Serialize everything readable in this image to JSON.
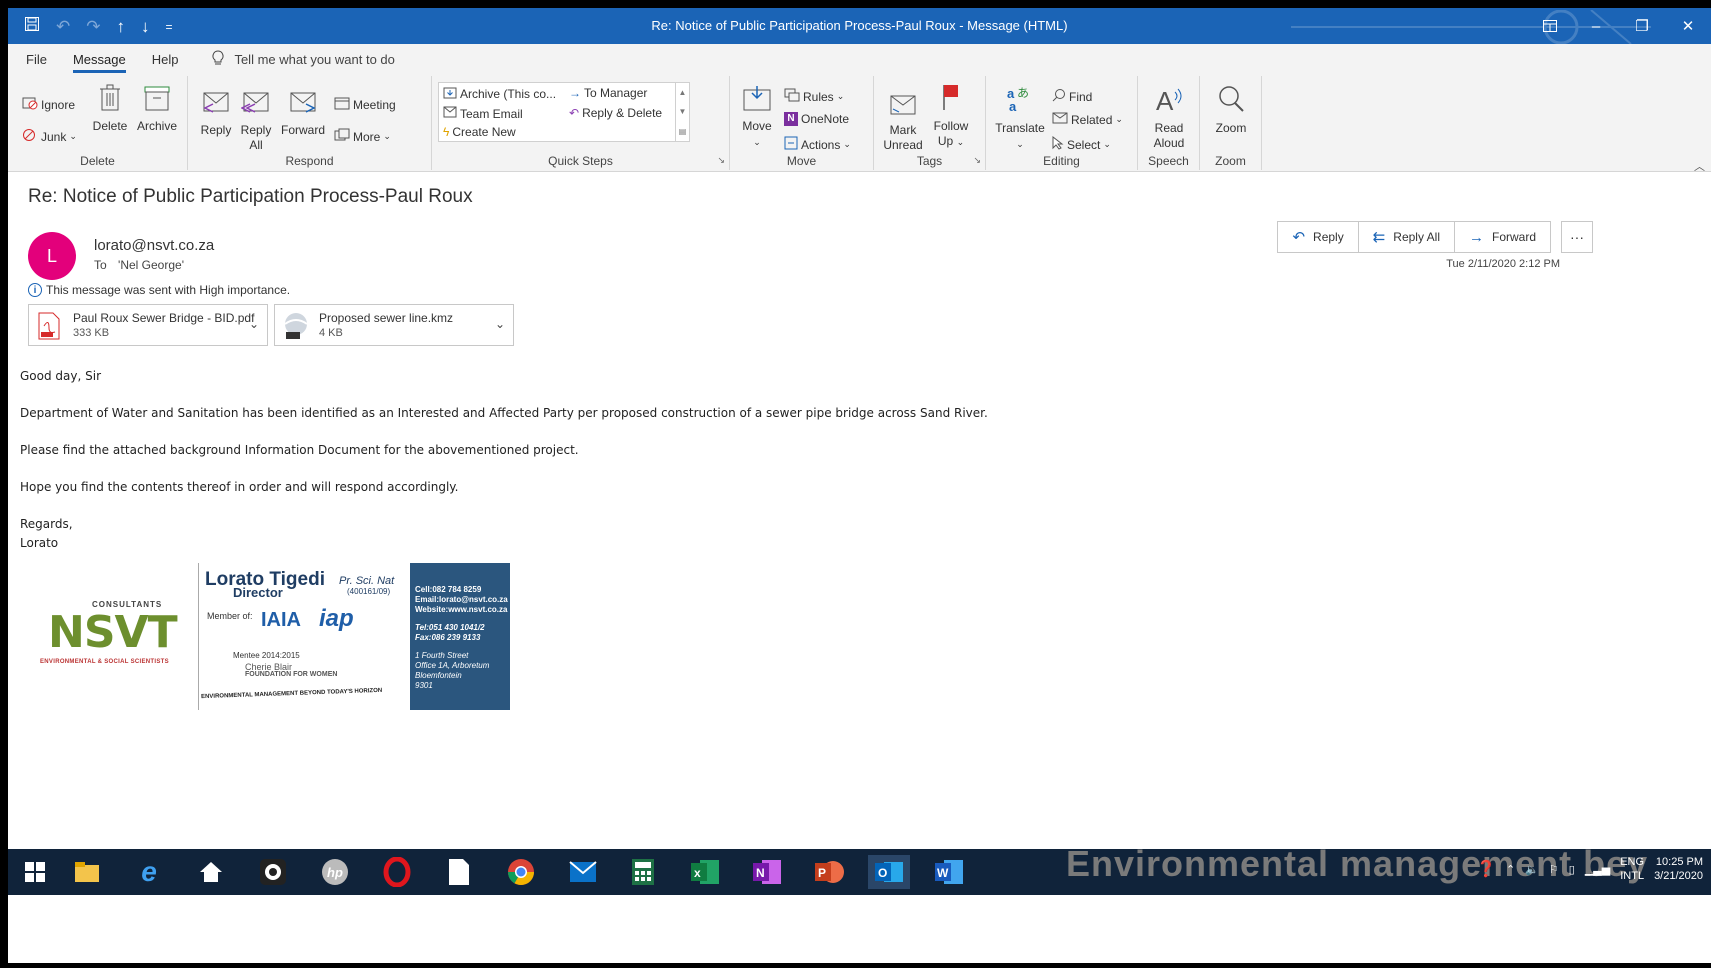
{
  "window": {
    "title": "Re: Notice of Public Participation Process-Paul Roux  -  Message (HTML)",
    "qat": [
      "save-icon",
      "undo-icon",
      "redo-icon",
      "up-arrow-icon",
      "down-arrow-icon",
      "customize-icon"
    ]
  },
  "tabs": {
    "file": "File",
    "message": "Message",
    "help": "Help",
    "tell_me": "Tell me what you want to do"
  },
  "ribbon": {
    "delete_group": {
      "label": "Delete",
      "ignore": "Ignore",
      "junk": "Junk",
      "delete": "Delete",
      "archive": "Archive"
    },
    "respond_group": {
      "label": "Respond",
      "reply": "Reply",
      "reply_all_1": "Reply",
      "reply_all_2": "All",
      "forward": "Forward",
      "meeting": "Meeting",
      "more": "More"
    },
    "quick_steps": {
      "label": "Quick Steps",
      "items": [
        "Archive (This co...",
        "Team Email",
        "Create New",
        "To Manager",
        "Reply & Delete"
      ]
    },
    "move_group": {
      "label": "Move",
      "move": "Move",
      "rules": "Rules",
      "onenote": "OneNote",
      "actions": "Actions"
    },
    "tags_group": {
      "label": "Tags",
      "mark_unread_1": "Mark",
      "mark_unread_2": "Unread",
      "follow_up_1": "Follow",
      "follow_up_2": "Up"
    },
    "editing_group": {
      "label": "Editing",
      "translate": "Translate",
      "find": "Find",
      "related": "Related",
      "select": "Select"
    },
    "speech_group": {
      "label": "Speech",
      "read_aloud_1": "Read",
      "read_aloud_2": "Aloud"
    },
    "zoom_group": {
      "label": "Zoom",
      "zoom": "Zoom"
    }
  },
  "message": {
    "subject": "Re: Notice of Public Participation Process-Paul Roux",
    "avatar_letter": "L",
    "sender": "lorato@nsvt.co.za",
    "to_label": "To",
    "to": "'Nel George'",
    "importance": "This message was sent with High importance.",
    "date": "Tue 2/11/2020 2:12 PM",
    "actions": {
      "reply": "Reply",
      "reply_all": "Reply All",
      "forward": "Forward",
      "more": "···"
    },
    "attachments": [
      {
        "name": "Paul Roux Sewer Bridge - BID.pdf",
        "size": "333 KB",
        "icon": "pdf-icon"
      },
      {
        "name": "Proposed sewer line.kmz",
        "size": "4 KB",
        "icon": "google-earth-icon"
      }
    ],
    "body": [
      "Good day, Sir",
      "Department of Water and Sanitation has been identified as an Interested and Affected Party per proposed construction of a sewer pipe bridge across Sand River.",
      "Please find the attached background Information Document for the abovementioned project.",
      "Hope you find the contents thereof in order and will respond accordingly."
    ],
    "regards": "Regards,",
    "signoff": "Lorato"
  },
  "signature": {
    "company_tag": "CONSULTANTS",
    "company_logo": "NSVT",
    "company_sub": "ENVIRONMENTAL & SOCIAL SCIENTISTS",
    "name": "Lorato Tigedi",
    "title_suffix": "Pr. Sci. Nat",
    "reg_no": "(400161/09)",
    "role": "Director",
    "member_of": "Member of:",
    "iaia": "IAIA",
    "iap": "iap",
    "mentee": "Mentee 2014:2015",
    "foundation_1": "Cherie Blair",
    "foundation_2": "FOUNDATION FOR WOMEN",
    "motto": "ENVIRONMENTAL MANAGEMENT BEYOND TODAY'S HORIZON",
    "cell": "Cell:082 784 8259",
    "email": "Email:lorato@nsvt.co.za",
    "website": "Website:www.nsvt.co.za",
    "tel": "Tel:051 430 1041/2",
    "fax": "Fax:086 239 9133",
    "address": [
      "1 Fourth Street",
      "Office 1A, Arboretum",
      "Bloemfontein",
      "9301"
    ]
  },
  "taskbar": {
    "apps": [
      "windows-start-icon",
      "file-explorer-icon",
      "internet-explorer-icon",
      "home-icon",
      "webcam-icon",
      "hp-icon",
      "opera-icon",
      "notepad-icon",
      "chrome-icon",
      "mail-icon",
      "calculator-icon",
      "excel-icon",
      "onenote-icon",
      "powerpoint-icon",
      "outlook-icon",
      "word-icon"
    ],
    "wallpaper_text": "Environmental management bey",
    "language_1": "ENG",
    "language_2": "INTL",
    "time": "10:25 PM",
    "date": "3/21/2020"
  },
  "colors": {
    "title_bar": "#1b64b6",
    "avatar": "#e3007b",
    "signature_panel": "#2b567e",
    "taskbar": "#10233a"
  }
}
